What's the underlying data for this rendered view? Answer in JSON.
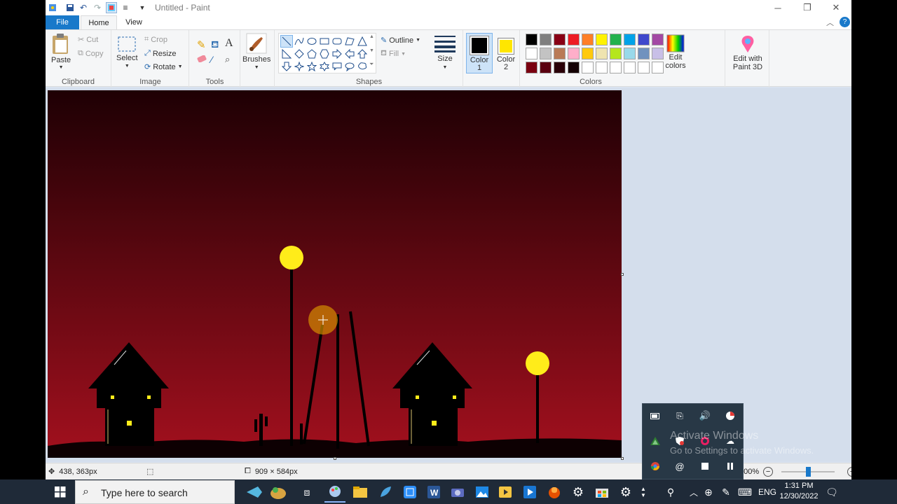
{
  "window": {
    "title": "Untitled - Paint",
    "tabs": {
      "file": "File",
      "home": "Home",
      "view": "View"
    }
  },
  "ribbon": {
    "clipboard": {
      "paste": "Paste",
      "cut": "Cut",
      "copy": "Copy",
      "label": "Clipboard"
    },
    "image": {
      "select": "Select",
      "crop": "Crop",
      "resize": "Resize",
      "rotate": "Rotate",
      "label": "Image"
    },
    "tools": {
      "label": "Tools"
    },
    "brushes": {
      "label": "Brushes"
    },
    "shapes": {
      "outline": "Outline",
      "fill": "Fill",
      "label": "Shapes"
    },
    "size": {
      "label": "Size"
    },
    "color1": {
      "label1": "Color",
      "label2": "1",
      "value": "#000000"
    },
    "color2": {
      "label1": "Color",
      "label2": "2",
      "value": "#ffe600"
    },
    "colors": {
      "label": "Colors",
      "edit": "Edit colors",
      "palette": [
        "#000000",
        "#7f7f7f",
        "#880015",
        "#ed1c24",
        "#ff7f27",
        "#fff200",
        "#22b14c",
        "#00a2e8",
        "#3f48cc",
        "#a349a4",
        "#ffffff",
        "#c3c3c3",
        "#b97a57",
        "#ffaec9",
        "#ffc90e",
        "#efe4b0",
        "#b5e61d",
        "#99d9ea",
        "#7092be",
        "#c8bfe7",
        "#7a0010",
        "#5a0010",
        "#2a0008",
        "#140004",
        "#ffffff",
        "#ffffff",
        "#ffffff",
        "#ffffff",
        "#ffffff",
        "#ffffff"
      ]
    },
    "paint3d": "Edit with Paint 3D"
  },
  "status": {
    "cursor_pos": "438, 363px",
    "selection_size": "",
    "image_size": "909 × 584px",
    "zoom": "100%"
  },
  "watermark": {
    "line1": "Activate Windows",
    "line2": "Go to Settings to activate Windows."
  },
  "taskbar": {
    "search_placeholder": "Type here to search",
    "lang": "ENG",
    "time": "1:31 PM",
    "date": "12/30/2022"
  },
  "painting": {
    "sky_top": "#1e0004",
    "sky_bottom": "#a3101e",
    "lamp_color": "#ffec1a"
  }
}
